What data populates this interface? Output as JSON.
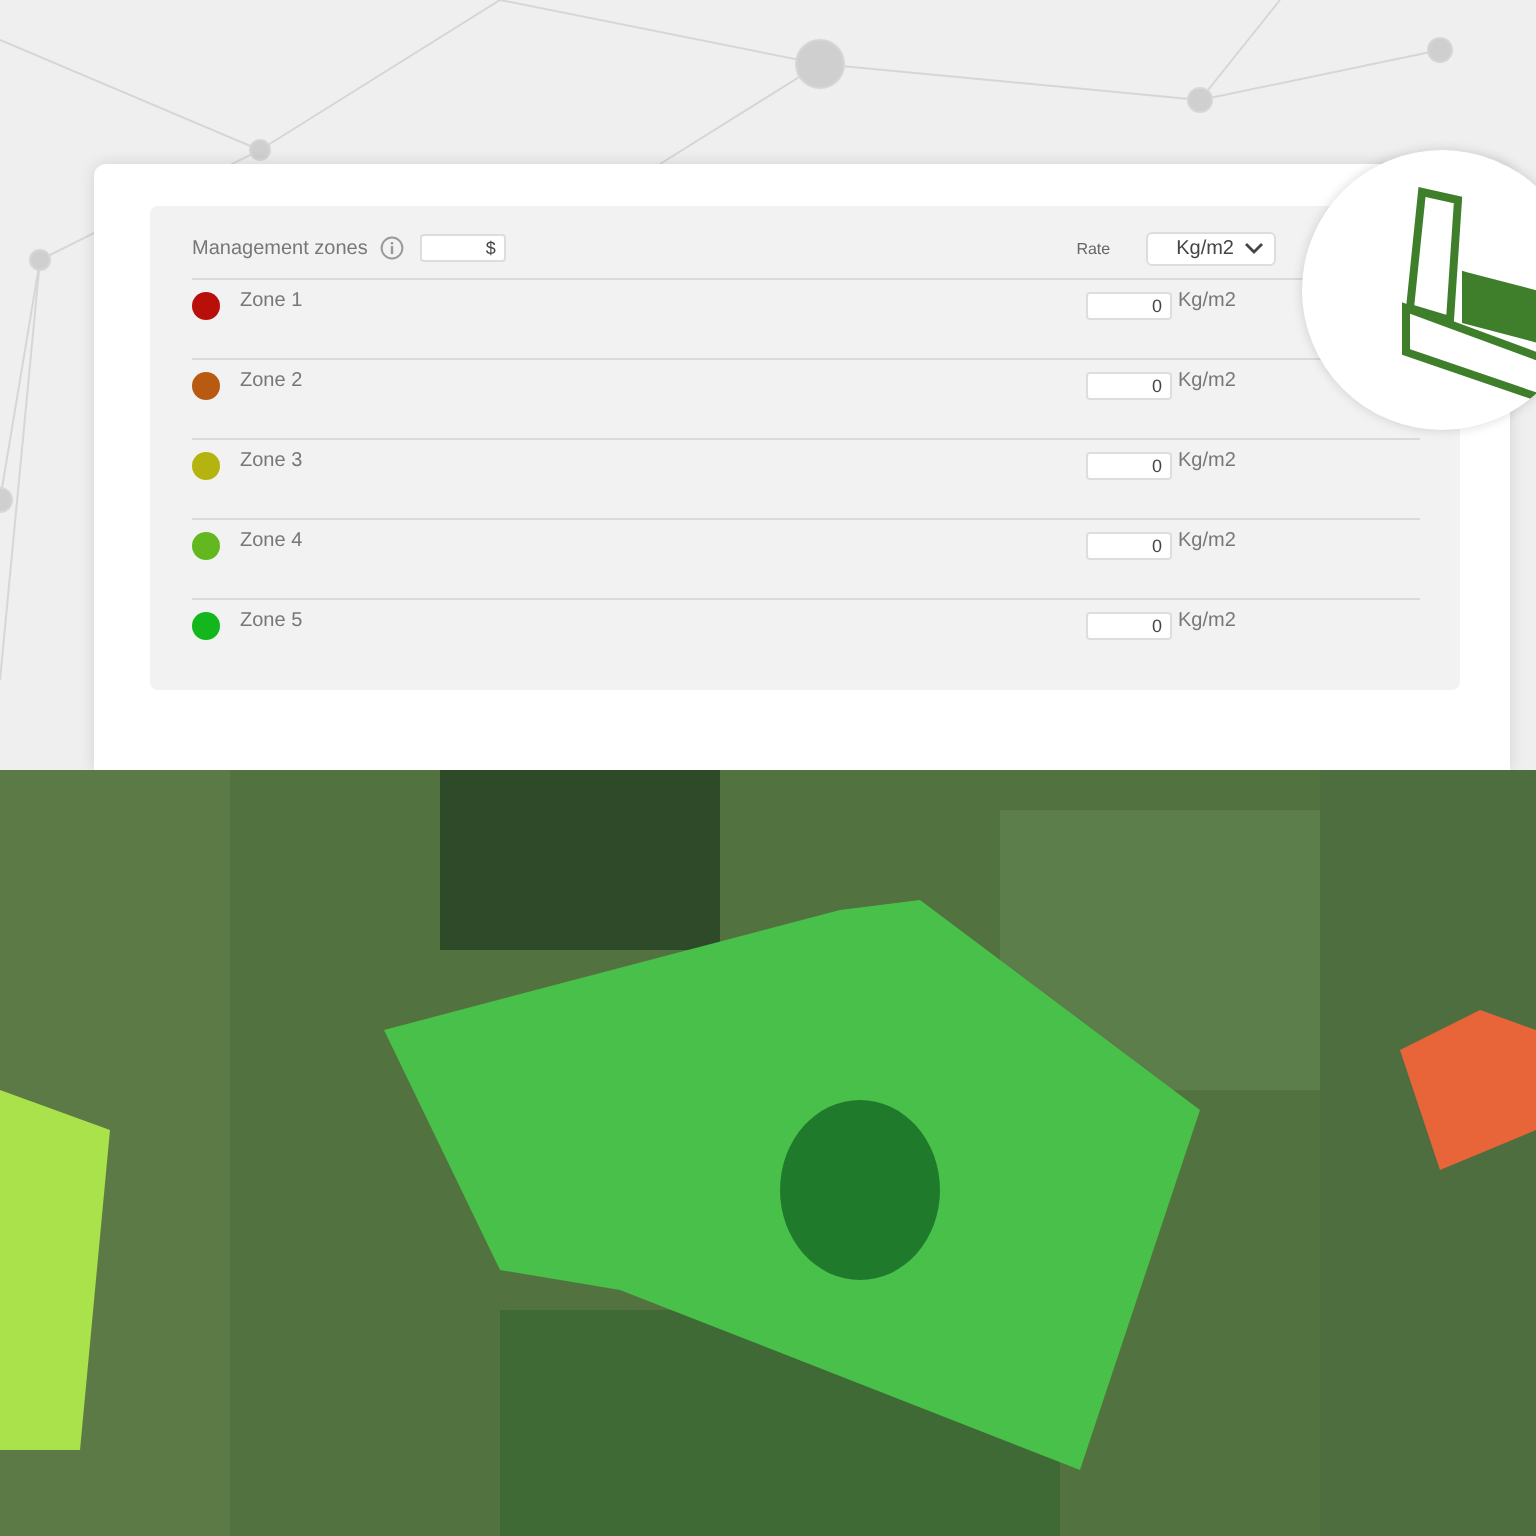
{
  "panel": {
    "title": "Management zones",
    "cost_field": {
      "value": "$"
    },
    "rate_label": "Rate",
    "rate_unit": "Kg/m2"
  },
  "zones": [
    {
      "name": "Zone 1",
      "color": "#b80f0a",
      "value": "0",
      "unit": "Kg/m2"
    },
    {
      "name": "Zone 2",
      "color": "#b85a12",
      "value": "0",
      "unit": "Kg/m2"
    },
    {
      "name": "Zone 3",
      "color": "#b5b30e",
      "value": "0",
      "unit": "Kg/m2"
    },
    {
      "name": "Zone 4",
      "color": "#62b81e",
      "value": "0",
      "unit": "Kg/m2"
    },
    {
      "name": "Zone 5",
      "color": "#12b81b",
      "value": "0",
      "unit": "Kg/m2"
    }
  ]
}
